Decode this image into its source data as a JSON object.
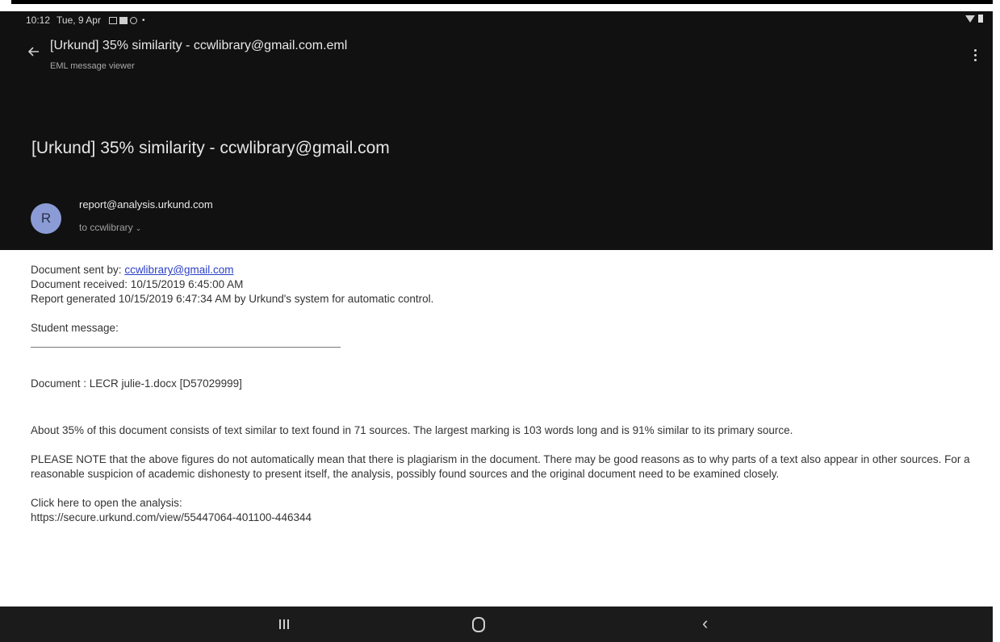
{
  "status_bar": {
    "time": "10:12",
    "date": "Tue, 9 Apr",
    "dot": "•"
  },
  "app_bar": {
    "title": "[Urkund] 35% similarity - ccwlibrary@gmail.com.eml",
    "subtitle": "EML message viewer",
    "back_icon": "arrow-back-icon",
    "menu_icon": "more-vert-icon"
  },
  "email": {
    "subject": "[Urkund] 35% similarity - ccwlibrary@gmail.com",
    "avatar_letter": "R",
    "avatar_color": "#8b9bd6",
    "from": "report@analysis.urkund.com",
    "to": "to ccwlibrary",
    "to_chevron": "⌄"
  },
  "body": {
    "sent_by_label": "Document sent by: ",
    "sent_by_link": "ccwlibrary@gmail.com",
    "received": "Document received: 10/15/2019 6:45:00 AM",
    "generated": "Report generated 10/15/2019 6:47:34 AM by Urkund's system for automatic control.",
    "student_message": "Student message:",
    "document": "Document : LECR julie-1.docx [D57029999]",
    "about": "About 35% of this document consists of text similar to text found in 71 sources. The largest marking is 103 words long and is 91% similar to its primary source.",
    "note": "PLEASE NOTE that the above figures do not automatically mean that there is plagiarism in the document. There may be good reasons as to why parts of a text also appear in other sources. For a reasonable suspicion of academic dishonesty to present itself, the analysis, possibly found sources and the original document need to be examined closely.",
    "click_here": "Click here to open the analysis:",
    "analysis_link": "https://secure.urkund.com/view/55447064-401100-446344"
  },
  "nav_bar": {
    "recents_icon": "recents-icon",
    "home_icon": "home-icon",
    "back_icon": "nav-back-icon",
    "back_glyph": "‹"
  },
  "colors": {
    "app_background": "#111111",
    "link": "#2a3fc4",
    "nav_background": "#1b1b1b"
  }
}
